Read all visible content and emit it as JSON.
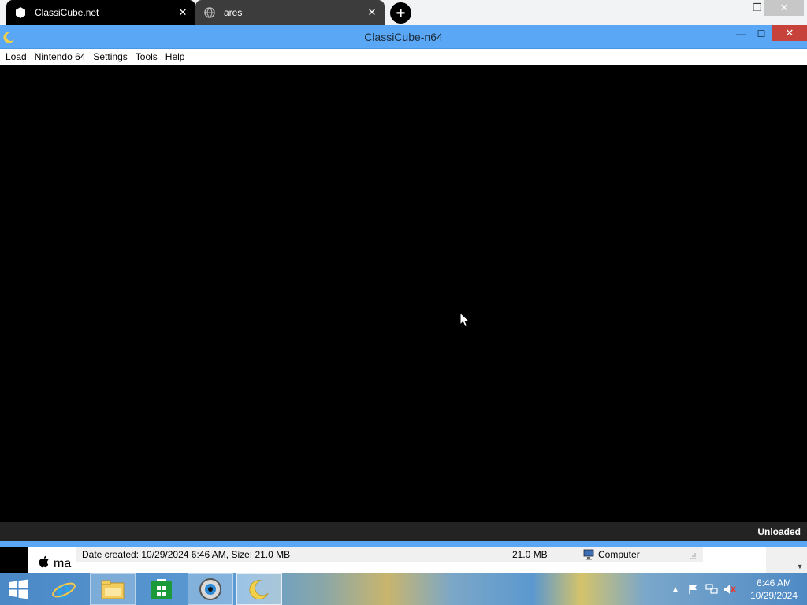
{
  "browser": {
    "tabs": [
      {
        "title": "ClassiCube.net",
        "icon": "hexagon-icon"
      },
      {
        "title": "ares",
        "icon": "globe-icon"
      }
    ],
    "new_tab_label": "+",
    "controls": {
      "minimize": "—",
      "maximize": "❐",
      "close": "✕"
    }
  },
  "app": {
    "title": "ClassiCube-n64",
    "icon": "crescent-moon-icon",
    "controls": {
      "minimize": "—",
      "maximize": "☐",
      "close": "✕"
    },
    "menu": [
      "Load",
      "Nintendo 64",
      "Settings",
      "Tools",
      "Help"
    ],
    "status": "Unloaded"
  },
  "explorer_behind": {
    "partial_text": "ma",
    "details": {
      "created": "Date created: 10/29/2024 6:46 AM, Size: 21.0 MB",
      "size": "21.0 MB",
      "zone": "Computer"
    }
  },
  "taskbar": {
    "items": [
      "windows-start-icon",
      "internet-explorer-icon",
      "file-explorer-icon",
      "windows-store-icon",
      "browser-globe-icon",
      "crescent-moon-icon"
    ],
    "clock": {
      "time": "6:46 AM",
      "date": "10/29/2024"
    }
  },
  "colors": {
    "titlebar": "#5aa7f5",
    "close_red": "#c7423b",
    "statusbar": "#232323"
  }
}
